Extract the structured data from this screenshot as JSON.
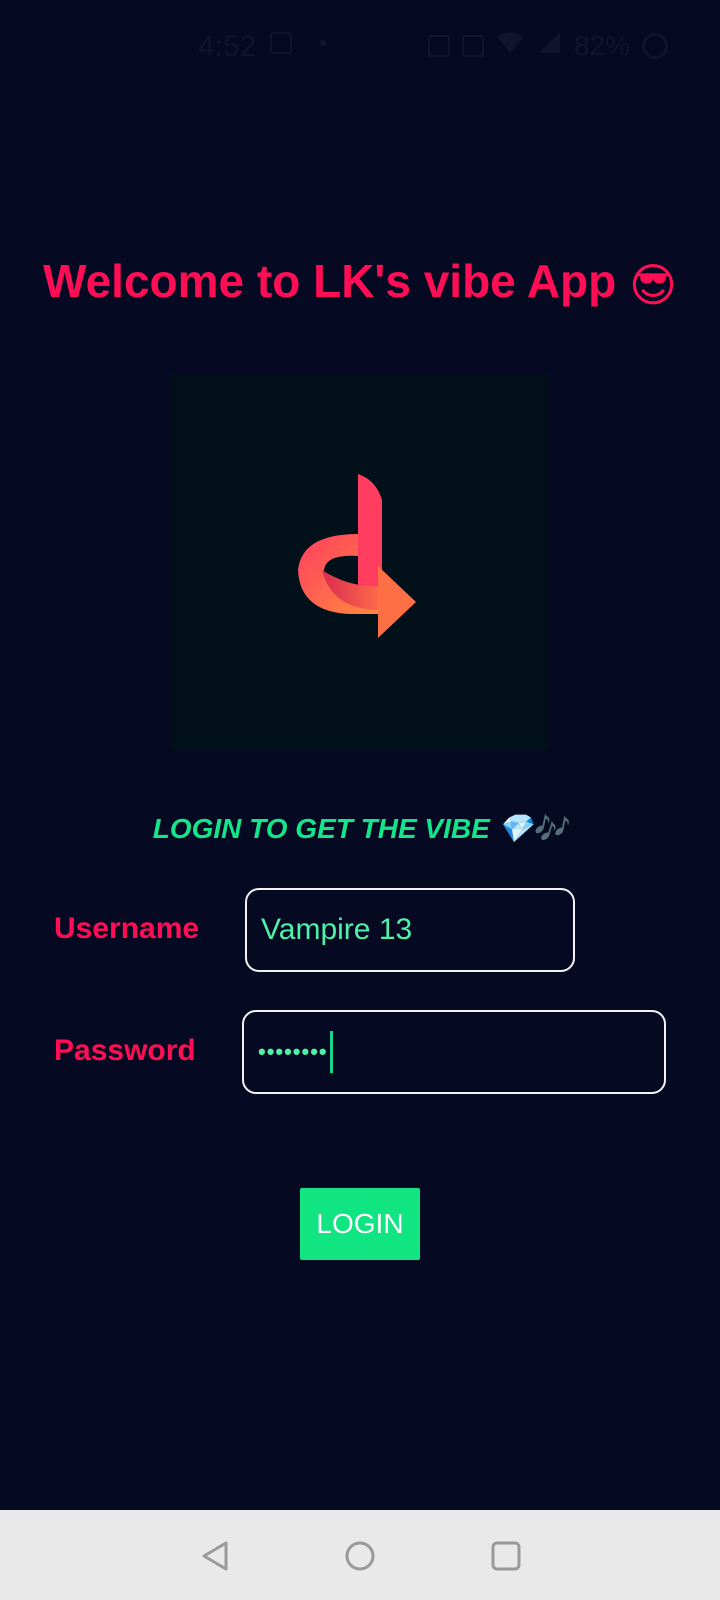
{
  "status_bar": {
    "time": "4:52",
    "battery": "82%",
    "icons": [
      "sim-icon",
      "dot-icon",
      "volte-icon",
      "data-icon",
      "vibrate-icon",
      "wifi-icon",
      "signal-icon",
      "battery-ring-icon"
    ]
  },
  "header": {
    "title": "Welcome to LK's vibe App",
    "emoji": "😎"
  },
  "tagline": {
    "text": "LOGIN TO GET THE VIBE",
    "emoji": "💎🎶"
  },
  "form": {
    "username_label": "Username",
    "username_value": "Vampire 13",
    "password_label": "Password",
    "password_masked": "••••••••",
    "login_label": "LOGIN"
  },
  "colors": {
    "background": "#050a22",
    "accent_pink": "#ff0d55",
    "accent_green": "#10e582",
    "logo_gradient": [
      "#ff3d62",
      "#ff8a3d"
    ]
  }
}
